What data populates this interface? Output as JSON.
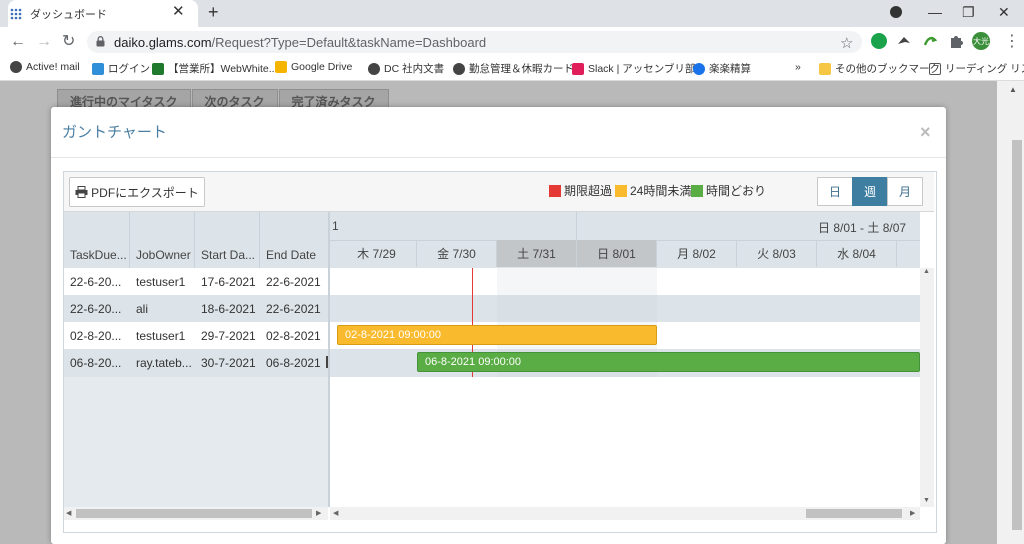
{
  "browser": {
    "tab_title": "ダッシュボード",
    "tab_close": "✕",
    "new_tab": "+",
    "url_host": "daiko.glams.com",
    "url_rest": "/Request?Type=Default&taskName=Dashboard",
    "window_controls": {
      "minimize": "—",
      "restore": "❐",
      "close": "✕"
    },
    "profile_label": "大光"
  },
  "bookmarks": [
    {
      "label": "Active! mail",
      "icon": "globe-icon",
      "color": "#444444"
    },
    {
      "label": "ログイン",
      "icon": "c-icon",
      "color": "#2f8fd8"
    },
    {
      "label": "【営業所】WebWhite...",
      "icon": "tree-icon",
      "color": "#1f7a2e"
    },
    {
      "label": "Google Drive",
      "icon": "drive-icon",
      "color": "#f4b400"
    },
    {
      "label": "DC  社内文書",
      "icon": "globe-icon",
      "color": "#444444"
    },
    {
      "label": "勤怠管理＆休暇カード",
      "icon": "globe-icon",
      "color": "#444444"
    },
    {
      "label": "Slack | アッセンブリ部...",
      "icon": "slack-icon",
      "color": "#e01e5a"
    },
    {
      "label": "楽楽精算",
      "icon": "rakuraku-icon",
      "color": "#1a73e8"
    }
  ],
  "bookmarks_more": "»",
  "bookmarks_other": "その他のブックマーク",
  "bookmarks_reading": "リーディング リスト",
  "background_tabs": [
    "進行中のマイタスク",
    "次のタスク",
    "完了済みタスク"
  ],
  "modal": {
    "title": "ガントチャート",
    "close": "×"
  },
  "gantt_toolbar": {
    "export_label": "PDFにエクスポート",
    "legend": [
      {
        "label": "期限超過",
        "color": "#e53935"
      },
      {
        "label": "24時間未満",
        "color": "#f9bb2d"
      },
      {
        "label": "時間どおり",
        "color": "#5aac44"
      }
    ],
    "views": [
      "日",
      "週",
      "月"
    ],
    "active_view": "週"
  },
  "grid": {
    "columns": [
      "TaskDue...",
      "JobOwner",
      "Start Da...",
      "End Date"
    ],
    "rows": [
      [
        "22-6-20...",
        "testuser1",
        "17-6-2021",
        "22-6-2021"
      ],
      [
        "22-6-20...",
        "ali",
        "18-6-2021",
        "22-6-2021"
      ],
      [
        "02-8-20...",
        "testuser1",
        "29-7-2021",
        "02-8-2021"
      ],
      [
        "06-8-20...",
        "ray.tateb...",
        "30-7-2021",
        "06-8-2021"
      ]
    ]
  },
  "timeline": {
    "week_left_partial": "1",
    "week_label": "日 8/01 - 土 8/07",
    "days": [
      {
        "label": "木 7/29",
        "weekend": false
      },
      {
        "label": "金 7/30",
        "weekend": false
      },
      {
        "label": "土 7/31",
        "weekend": true
      },
      {
        "label": "日 8/01",
        "weekend": true
      },
      {
        "label": "月 8/02",
        "weekend": false
      },
      {
        "label": "火 8/03",
        "weekend": false
      },
      {
        "label": "水 8/04",
        "weekend": false
      }
    ],
    "bars": [
      {
        "row": 2,
        "label": "02-8-2021 09:00:00",
        "status": "24時間未満",
        "color": "#f9bb2d"
      },
      {
        "row": 3,
        "label": "06-8-2021 09:00:00",
        "status": "時間どおり",
        "color": "#5aac44"
      }
    ]
  },
  "colors": {
    "accent": "#3e7ea1",
    "header_bg": "#dde4e9",
    "today_line": "#e53935"
  }
}
